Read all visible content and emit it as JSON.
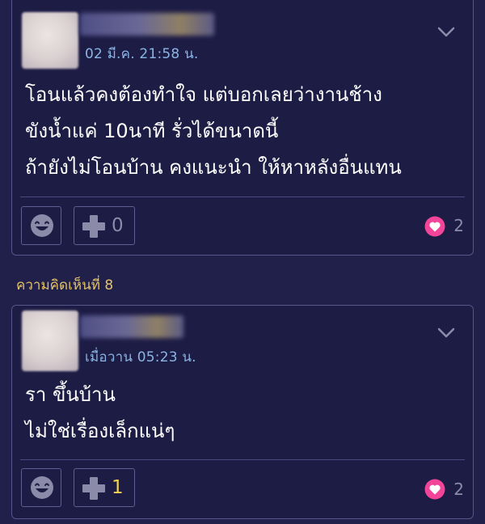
{
  "comments": [
    {
      "timestamp": "02 มี.ค. 21:58 น.",
      "body_lines": [
        "โอนแล้วคงต้องทำใจ แต่บอกเลยว่างานช้าง",
        "ขังน้ำแค่ 10นาที รั่วได้ขนาดนี้",
        "ถ้ายังไม่โอนบ้าน คงแนะนำ ให้หาหลังอื่นแทน"
      ],
      "plus_count": "0",
      "heart_count": "2"
    },
    {
      "label": "ความคิดเห็นที่ 8",
      "timestamp": "เมื่อวาน  05:23 น.",
      "body_lines": [
        "รา ขึ้นบ้าน",
        "ไม่ใช่เรื่องเล็กแน่ๆ"
      ],
      "plus_count": "1",
      "heart_count": "2"
    }
  ],
  "icons": {
    "emoji": "smiley-icon",
    "plus": "plus-icon",
    "heart": "heart-icon",
    "menu": "chevron-down-icon"
  },
  "colors": {
    "background": "#21204a",
    "card": "#1d1c45",
    "timestamp": "#8ab4e3",
    "label": "#e2c268",
    "heart": "#f2459a",
    "active_count": "#f1d34a"
  }
}
